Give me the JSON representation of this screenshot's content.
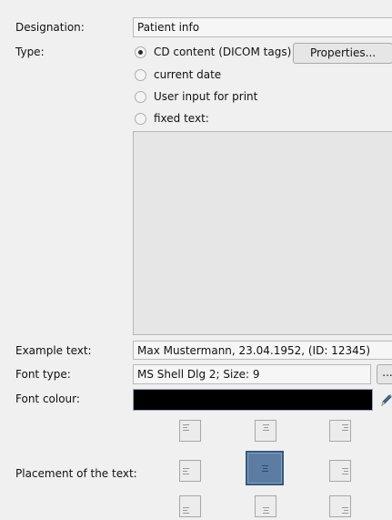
{
  "designation": {
    "label": "Designation:",
    "value": "Patient info"
  },
  "type": {
    "label": "Type:",
    "options": [
      {
        "label": "CD content (DICOM tags)",
        "selected": true
      },
      {
        "label": "current date",
        "selected": false
      },
      {
        "label": "User input for print",
        "selected": false
      },
      {
        "label": "fixed text:",
        "selected": false
      }
    ],
    "properties_button": "Properties..."
  },
  "fixed_text": {
    "value": ""
  },
  "example": {
    "label": "Example text:",
    "value": "Max Mustermann, 23.04.1952, (ID: 12345)"
  },
  "font_type": {
    "label": "Font type:",
    "value": "MS Shell Dlg 2; Size: 9",
    "browse_button": "..."
  },
  "font_colour": {
    "label": "Font colour:",
    "color": "#000000",
    "picker_icon": "pencil-icon"
  },
  "placement": {
    "label": "Placement of the text:",
    "selected": "middle-center",
    "options": [
      "top-left",
      "top-center",
      "top-right",
      "middle-left",
      "middle-center",
      "middle-right",
      "bottom-left",
      "bottom-center",
      "bottom-right"
    ]
  }
}
